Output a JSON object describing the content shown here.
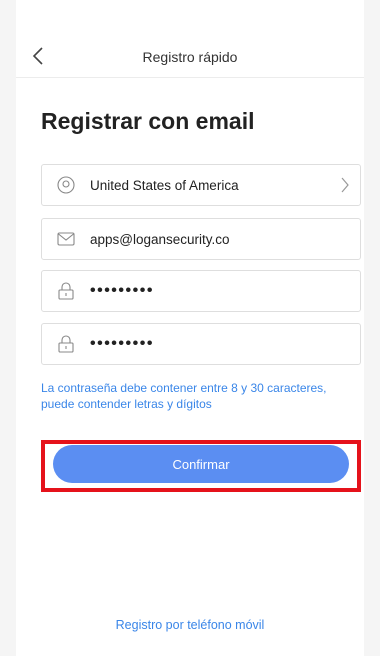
{
  "header": {
    "title": "Registro rápido",
    "back_icon": "chevron-left-icon"
  },
  "heading": "Registrar con email",
  "form": {
    "country": {
      "value": "United States of America",
      "icon": "location-pin-icon",
      "trailing_icon": "chevron-right-icon"
    },
    "email": {
      "value": "apps@logansecurity.co",
      "icon": "mail-icon"
    },
    "password": {
      "value": "•••••••••",
      "icon": "lock-icon"
    },
    "confirm_password": {
      "value": "•••••••••",
      "icon": "lock-icon"
    }
  },
  "hint": "La contraseña debe contener entre 8 y 30 caracteres, puede contender letras y dígitos",
  "confirm_button": {
    "label": "Confirmar"
  },
  "phone_link": "Registro por teléfono móvil",
  "colors": {
    "accent": "#5b8ef2",
    "link": "#3a86e8",
    "highlight": "#e5121b"
  }
}
